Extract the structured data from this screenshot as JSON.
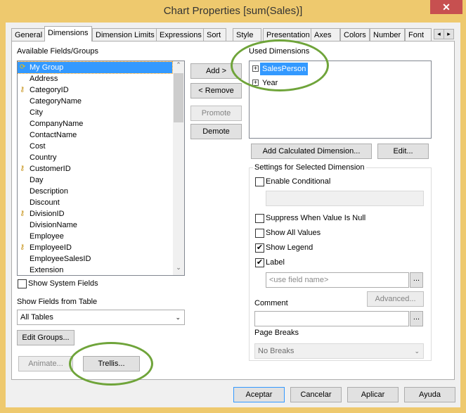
{
  "window": {
    "title": "Chart Properties [sum(Sales)]",
    "close": "✕"
  },
  "tabs": [
    "General",
    "Dimensions",
    "Dimension Limits",
    "Expressions",
    "Sort",
    "Style",
    "Presentation",
    "Axes",
    "Colors",
    "Number",
    "Font"
  ],
  "tab_scroll": {
    "left": "◂",
    "right": "▸"
  },
  "available": {
    "label": "Available Fields/Groups",
    "items": [
      {
        "label": "My Group",
        "icon": "group-icon",
        "selected": true
      },
      {
        "label": "Address"
      },
      {
        "label": "CategoryID",
        "icon": "key-icon"
      },
      {
        "label": "CategoryName"
      },
      {
        "label": "City"
      },
      {
        "label": "CompanyName"
      },
      {
        "label": "ContactName"
      },
      {
        "label": "Cost"
      },
      {
        "label": "Country"
      },
      {
        "label": "CustomerID",
        "icon": "key-icon"
      },
      {
        "label": "Day"
      },
      {
        "label": "Description"
      },
      {
        "label": "Discount"
      },
      {
        "label": "DivisionID",
        "icon": "key-icon"
      },
      {
        "label": "DivisionName"
      },
      {
        "label": "Employee"
      },
      {
        "label": "EmployeeID",
        "icon": "key-icon"
      },
      {
        "label": "EmployeeSalesID"
      },
      {
        "label": "Extension"
      }
    ]
  },
  "show_system_fields": "Show System Fields",
  "show_fields_from": {
    "label": "Show Fields from Table",
    "value": "All Tables"
  },
  "buttons": {
    "add": "Add >",
    "remove": "< Remove",
    "promote": "Promote",
    "demote": "Demote",
    "edit_groups": "Edit Groups...",
    "animate": "Animate...",
    "trellis": "Trellis...",
    "add_calc": "Add Calculated Dimension...",
    "edit": "Edit...",
    "advanced": "Advanced...",
    "ellipsis": "..."
  },
  "used": {
    "label": "Used Dimensions",
    "items": [
      {
        "label": "SalesPerson",
        "selected": true
      },
      {
        "label": "Year"
      }
    ]
  },
  "settings": {
    "title": "Settings for Selected Dimension",
    "enable_conditional": "Enable Conditional",
    "suppress_null": "Suppress When Value Is Null",
    "show_all": "Show All Values",
    "show_legend": "Show Legend",
    "label": "Label",
    "label_placeholder": "<use field name>",
    "comment": "Comment",
    "page_breaks": "Page Breaks",
    "page_breaks_value": "No Breaks"
  },
  "footer": {
    "ok": "Aceptar",
    "cancel": "Cancelar",
    "apply": "Aplicar",
    "help": "Ayuda"
  }
}
